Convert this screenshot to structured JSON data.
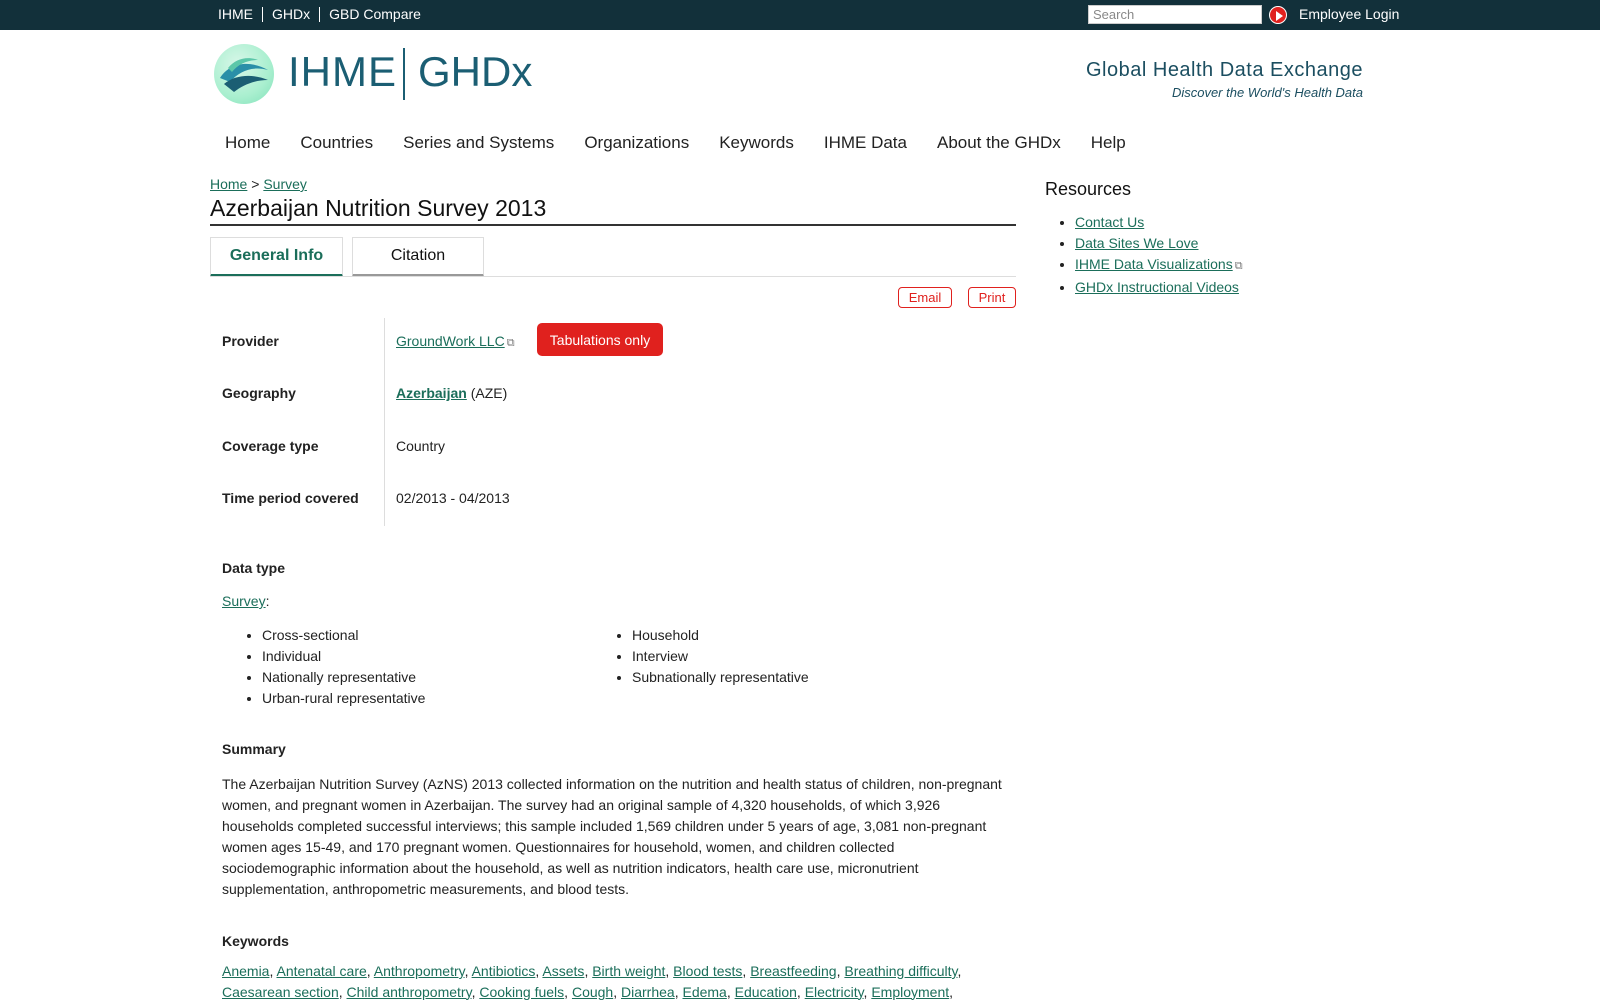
{
  "topbar": {
    "links": [
      "IHME",
      "GHDx",
      "GBD Compare"
    ],
    "search_placeholder": "Search",
    "employee_login": "Employee Login"
  },
  "header": {
    "logo_ihme": "IHME",
    "logo_ghdx": "GHDx",
    "tagline": "Global Health Data Exchange",
    "subtagline": "Discover the World's Health Data"
  },
  "nav": {
    "items": [
      "Home",
      "Countries",
      "Series and Systems",
      "Organizations",
      "Keywords",
      "IHME Data",
      "About the GHDx",
      "Help"
    ]
  },
  "breadcrumb": {
    "home": "Home",
    "sep": ">",
    "survey": "Survey"
  },
  "page_title": "Azerbaijan Nutrition Survey 2013",
  "tabs": {
    "general": "General Info",
    "citation": "Citation"
  },
  "actions": {
    "email": "Email",
    "print": "Print"
  },
  "info": {
    "provider_label": "Provider",
    "provider_value": "GroundWork LLC",
    "provider_badge": "Tabulations only",
    "geography_label": "Geography",
    "geography_value": "Azerbaijan",
    "geography_code": "(AZE)",
    "coverage_label": "Coverage type",
    "coverage_value": "Country",
    "time_label": "Time period covered",
    "time_value": "02/2013 - 04/2013"
  },
  "data_type": {
    "heading": "Data type",
    "link": "Survey",
    "col1": [
      "Cross-sectional",
      "Individual",
      "Nationally representative",
      "Urban-rural representative"
    ],
    "col2": [
      "Household",
      "Interview",
      "Subnationally representative"
    ]
  },
  "summary": {
    "heading": "Summary",
    "text": "The Azerbaijan Nutrition Survey (AzNS) 2013 collected information on the nutrition and health status of children, non-pregnant women, and pregnant women in Azerbaijan. The survey had an original sample of 4,320 households, of which 3,926 households completed successful interviews; this sample included 1,569 children under 5 years of age, 3,081 non-pregnant women ages 15-49, and 170 pregnant women. Questionnaires for household, women, and children collected sociodemographic information about the household, as well as nutrition indicators, health care use, micronutrient supplementation, anthropometric measurements, and blood tests."
  },
  "keywords": {
    "heading": "Keywords",
    "items": [
      "Anemia",
      "Antenatal care",
      "Anthropometry",
      "Antibiotics",
      "Assets",
      "Birth weight",
      "Blood tests",
      "Breastfeeding",
      "Breathing difficulty",
      "Caesarean section",
      "Child anthropometry",
      "Cooking fuels",
      "Cough",
      "Diarrhea",
      "Edema",
      "Education",
      "Electricity",
      "Employment"
    ]
  },
  "resources": {
    "title": "Resources",
    "items": [
      "Contact Us",
      "Data Sites We Love",
      "IHME Data Visualizations",
      "GHDx Instructional Videos"
    ]
  },
  "colors": {
    "topbar": "#12303a",
    "accent_red": "#e0211e",
    "link_green": "#1b6e5a",
    "brand_blue": "#1b5e73"
  }
}
